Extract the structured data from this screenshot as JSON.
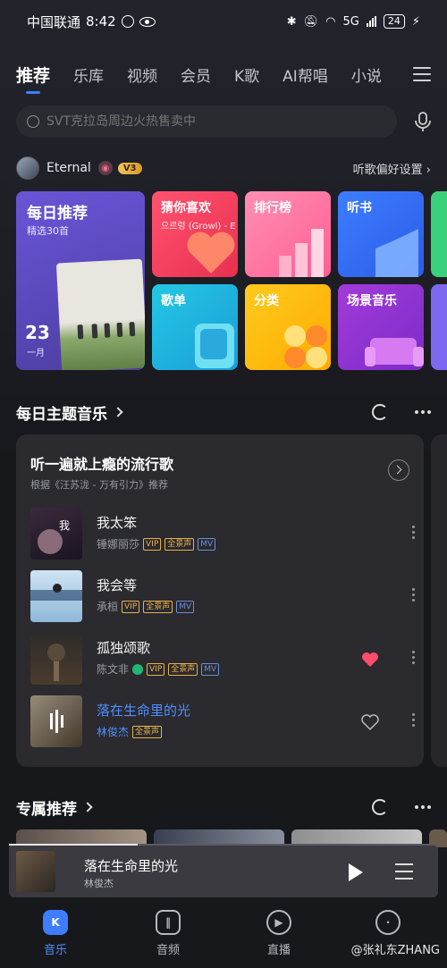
{
  "status": {
    "carrier": "中国联通",
    "time": "8:42",
    "network": "5G",
    "battery": "24"
  },
  "nav": {
    "tabs": [
      "推荐",
      "乐库",
      "视频",
      "会员",
      "K歌",
      "AI帮唱",
      "小说"
    ],
    "active": "推荐"
  },
  "search": {
    "placeholder": "SVT克拉岛周边火热售卖中"
  },
  "user": {
    "name": "Eternal",
    "level": "V3",
    "pref_link": "听歌偏好设置 ›"
  },
  "daily": {
    "title": "每日推荐",
    "subtitle": "精选30首",
    "day": "23",
    "month": "一月"
  },
  "tiles": [
    {
      "label": "猜你喜欢",
      "sub": "으르렁 (Growl) - E"
    },
    {
      "label": "排行榜"
    },
    {
      "label": "听书"
    },
    {
      "label": "歌单"
    },
    {
      "label": "分类"
    },
    {
      "label": "场景音乐"
    }
  ],
  "theme_section": {
    "title": "每日主题音乐",
    "card_title": "听一遍就上瘾的流行歌",
    "card_sub": "根据《汪苏泷 - 万有引力》推荐",
    "songs": [
      {
        "name": "我太笨",
        "artist": "锤娜丽莎",
        "tags": [
          "VIP",
          "全景声",
          "MV"
        ],
        "liked": false,
        "playing": false
      },
      {
        "name": "我会等",
        "artist": "承桓",
        "tags": [
          "VIP",
          "全景声",
          "MV"
        ],
        "liked": false,
        "playing": false
      },
      {
        "name": "孤独颂歌",
        "artist": "陈文非",
        "tags": [
          "VIP",
          "全景声",
          "MV"
        ],
        "liked": true,
        "playing": false
      },
      {
        "name": "落在生命里的光",
        "artist": "林俊杰",
        "tags": [
          "全景声"
        ],
        "liked": false,
        "playing": true
      }
    ]
  },
  "personal_section": {
    "title": "专属推荐"
  },
  "mini_player": {
    "title": "落在生命里的光",
    "artist": "林俊杰",
    "progress": 0.3
  },
  "bottom_nav": [
    {
      "label": "音乐",
      "icon": "K",
      "active": true
    },
    {
      "label": "音频",
      "icon": "",
      "active": false
    },
    {
      "label": "直播",
      "icon": "",
      "active": false
    },
    {
      "label": "",
      "icon": "",
      "active": false
    }
  ],
  "watermark": "@张礼东ZHANG",
  "colors": {
    "accent": "#3d7dff",
    "liked": "#ff4d6a",
    "playing": "#4f8fff",
    "vip": "#e8b14a"
  }
}
